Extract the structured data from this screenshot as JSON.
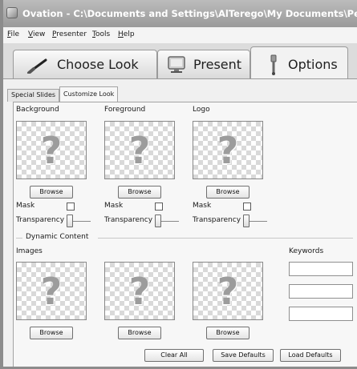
{
  "window": {
    "title": "Ovation - C:\\Documents and Settings\\AlTerego\\My Documents\\Percheron Center"
  },
  "menu": [
    {
      "label": "File",
      "accel": "F",
      "rest": "ile"
    },
    {
      "label": "View",
      "accel": "V",
      "rest": "iew"
    },
    {
      "label": "Presenter",
      "accel": "P",
      "rest": "resenter"
    },
    {
      "label": "Tools",
      "accel": "T",
      "rest": "ools"
    },
    {
      "label": "Help",
      "accel": "H",
      "rest": "elp"
    }
  ],
  "main_tabs": [
    {
      "label": "Choose Look",
      "icon": "brush-icon",
      "active": false
    },
    {
      "label": "Present",
      "icon": "monitor-icon",
      "active": false
    },
    {
      "label": "Options",
      "icon": "tools-icon",
      "active": true
    }
  ],
  "sub_tabs": [
    {
      "label": "Special Slides",
      "active": false
    },
    {
      "label": "Customize Look",
      "active": true
    }
  ],
  "images_row1": [
    {
      "label": "Background",
      "button": "Browse",
      "mask_label": "Mask",
      "transparency_label": "Transparency",
      "placeholder": "?"
    },
    {
      "label": "Foreground",
      "button": "Browse",
      "mask_label": "Mask",
      "transparency_label": "Transparency",
      "placeholder": "?"
    },
    {
      "label": "Logo",
      "button": "Browse",
      "mask_label": "Mask",
      "transparency_label": "Transparency",
      "placeholder": "?"
    }
  ],
  "dynamic": {
    "section_label": "Dynamic Content",
    "images_label": "Images",
    "keywords_label": "Keywords",
    "images": [
      {
        "button": "Browse",
        "placeholder": "?"
      },
      {
        "button": "Browse",
        "placeholder": "?"
      },
      {
        "button": "Browse",
        "placeholder": "?"
      }
    ],
    "keywords": [
      "",
      "",
      ""
    ]
  },
  "footer": {
    "clear_all": "Clear All",
    "save_defaults": "Save Defaults",
    "load_defaults": "Load Defaults"
  },
  "colors": {
    "title_bar": "#a9a9a9",
    "tab_strip": "#dcdcdc",
    "panel": "#f7f7f7"
  }
}
